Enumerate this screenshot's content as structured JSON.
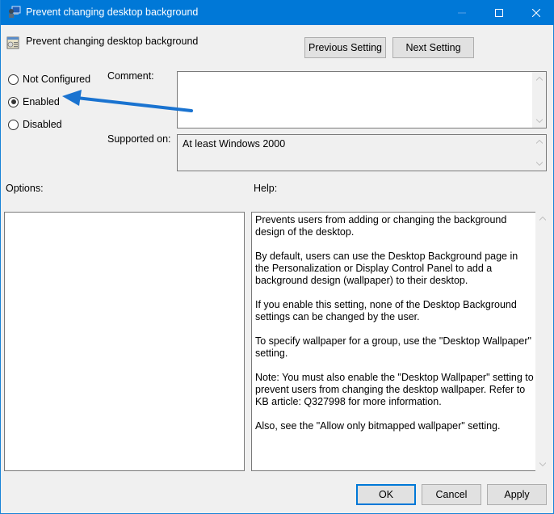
{
  "window": {
    "title": "Prevent changing desktop background",
    "icons": {
      "app": "group-policy-computer-icon",
      "minimize": "minimize-icon",
      "maximize": "maximize-icon",
      "close": "close-icon"
    }
  },
  "policy": {
    "name": "Prevent changing desktop background",
    "icon": "policy-setting-icon"
  },
  "nav": {
    "previous_label": "Previous Setting",
    "next_label": "Next Setting"
  },
  "state": {
    "options": [
      {
        "label": "Not Configured",
        "checked": false
      },
      {
        "label": "Enabled",
        "checked": true
      },
      {
        "label": "Disabled",
        "checked": false
      }
    ]
  },
  "comment": {
    "label": "Comment:",
    "value": ""
  },
  "supported": {
    "label": "Supported on:",
    "value": "At least Windows 2000"
  },
  "options_panel": {
    "label": "Options:"
  },
  "help_panel": {
    "label": "Help:",
    "paragraphs": [
      "Prevents users from adding or changing the background design of the desktop.",
      "By default, users can use the Desktop Background page in the Personalization or Display Control Panel to add a background design (wallpaper) to their desktop.",
      "If you enable this setting, none of the Desktop Background settings can be changed by the user.",
      "To specify wallpaper for a group, use the \"Desktop Wallpaper\" setting.",
      "Note: You must also enable the \"Desktop Wallpaper\" setting to prevent users from changing the desktop wallpaper. Refer to KB article: Q327998 for more information.",
      "Also, see the \"Allow only bitmapped wallpaper\" setting."
    ]
  },
  "footer": {
    "ok_label": "OK",
    "cancel_label": "Cancel",
    "apply_label": "Apply"
  },
  "annotation": {
    "type": "arrow",
    "color": "#1a73d0",
    "points_to": "Enabled"
  }
}
